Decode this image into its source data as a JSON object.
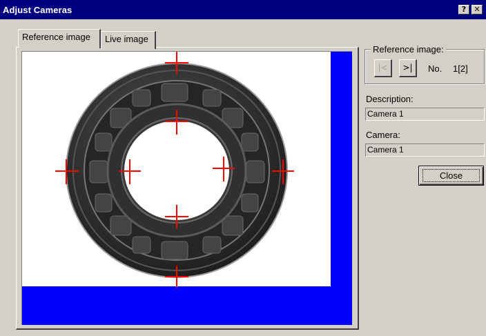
{
  "window": {
    "title": "Adjust Cameras",
    "help_glyph": "?",
    "close_glyph": "✕"
  },
  "tabs": [
    {
      "label": "Reference image",
      "selected": true
    },
    {
      "label": "Live image",
      "selected": false
    }
  ],
  "reference_group": {
    "legend": "Reference image:",
    "first_glyph": "|<",
    "last_glyph": ">|",
    "number_label": "No.",
    "number_value": "1[2]"
  },
  "description": {
    "label": "Description:",
    "value": "Camera 1"
  },
  "camera": {
    "label": "Camera:",
    "value": "Camera 1"
  },
  "close_label": "Close",
  "image": {
    "subject": "bearing-photo",
    "crosshair_color": "#ff0000",
    "background_color": "#0000ff"
  },
  "colors": {
    "titlebar": "#000080",
    "face": "#d4d0c8"
  }
}
